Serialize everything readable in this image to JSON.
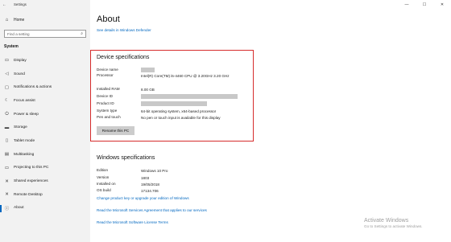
{
  "window": {
    "title": "Settings",
    "back": "←",
    "controls": [
      "—",
      "☐",
      "✕"
    ]
  },
  "sidebar": {
    "home": {
      "icon": "⌂",
      "label": "Home"
    },
    "search": {
      "placeholder": "Find a setting",
      "icon": "⌕"
    },
    "section": "System",
    "items": [
      {
        "icon": "▭",
        "label": "Display"
      },
      {
        "icon": "◁",
        "label": "Sound"
      },
      {
        "icon": "▢",
        "label": "Notifications & actions"
      },
      {
        "icon": "☾",
        "label": "Focus assist"
      },
      {
        "icon": "⏻",
        "label": "Power & sleep"
      },
      {
        "icon": "▬",
        "label": "Storage"
      },
      {
        "icon": "▯",
        "label": "Tablet mode"
      },
      {
        "icon": "▤",
        "label": "Multitasking"
      },
      {
        "icon": "▭",
        "label": "Projecting to this PC"
      },
      {
        "icon": "✕",
        "label": "Shared experiences"
      },
      {
        "icon": "✕",
        "label": "Remote Desktop"
      },
      {
        "icon": "ⓘ",
        "label": "About"
      }
    ]
  },
  "main": {
    "title": "About",
    "defender_link": "See details in Windows Defender",
    "device_specs": {
      "heading": "Device specifications",
      "rows": [
        {
          "key": "Device name",
          "value": ""
        },
        {
          "key": "Processor",
          "value": "Intel(R) Core(TM) i5-4460 CPU @ 3.20GHz 3.20 GHz"
        },
        {
          "key": "Installed RAM",
          "value": "8.00 GB"
        },
        {
          "key": "Device ID",
          "value": ""
        },
        {
          "key": "Product ID",
          "value": ""
        },
        {
          "key": "System type",
          "value": "64-bit operating system, x64-based processor"
        },
        {
          "key": "Pen and touch",
          "value": "No pen or touch input is available for this display"
        }
      ],
      "rename_button": "Rename this PC"
    },
    "windows_specs": {
      "heading": "Windows specifications",
      "rows": [
        {
          "key": "Edition",
          "value": "Windows 10 Pro"
        },
        {
          "key": "Version",
          "value": "1803"
        },
        {
          "key": "Installed on",
          "value": "19/05/2018"
        },
        {
          "key": "OS build",
          "value": "17134.706"
        }
      ],
      "links": [
        "Change product key or upgrade your edition of Windows",
        "Read the Microsoft Services Agreement that applies to our services",
        "Read the Microsoft Software License Terms"
      ]
    }
  },
  "watermark": {
    "line1": "Activate Windows",
    "line2": "Go to Settings to activate Windows."
  }
}
